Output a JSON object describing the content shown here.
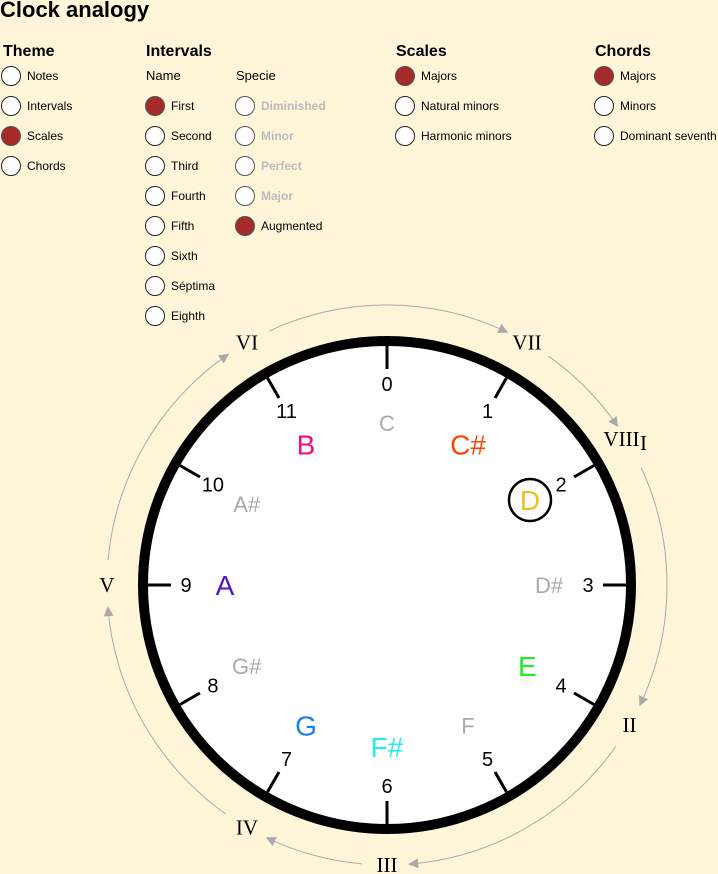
{
  "title": "Clock analogy",
  "theme": {
    "title": "Theme",
    "options": [
      {
        "label": "Notes",
        "selected": false
      },
      {
        "label": "Intervals",
        "selected": false
      },
      {
        "label": "Scales",
        "selected": true
      },
      {
        "label": "Chords",
        "selected": false
      }
    ]
  },
  "intervals": {
    "title": "Intervals",
    "name_header": "Name",
    "specie_header": "Specie",
    "names": [
      {
        "label": "First",
        "selected": true
      },
      {
        "label": "Second",
        "selected": false
      },
      {
        "label": "Third",
        "selected": false
      },
      {
        "label": "Fourth",
        "selected": false
      },
      {
        "label": "Fifth",
        "selected": false
      },
      {
        "label": "Sixth",
        "selected": false
      },
      {
        "label": "Séptima",
        "selected": false
      },
      {
        "label": "Eighth",
        "selected": false
      }
    ],
    "species": [
      {
        "label": "Diminished",
        "selected": false,
        "disabled": true
      },
      {
        "label": "Minor",
        "selected": false,
        "disabled": true
      },
      {
        "label": "Perfect",
        "selected": false,
        "disabled": true
      },
      {
        "label": "Major",
        "selected": false,
        "disabled": true
      },
      {
        "label": "Augmented",
        "selected": true,
        "disabled": false
      }
    ]
  },
  "scales": {
    "title": "Scales",
    "options": [
      {
        "label": "Majors",
        "selected": true
      },
      {
        "label": "Natural minors",
        "selected": false
      },
      {
        "label": "Harmonic minors",
        "selected": false
      }
    ]
  },
  "chords": {
    "title": "Chords",
    "options": [
      {
        "label": "Majors",
        "selected": true
      },
      {
        "label": "Minors",
        "selected": false
      },
      {
        "label": "Dominant seventh",
        "selected": false
      }
    ]
  },
  "clock": {
    "hours": [
      "0",
      "1",
      "2",
      "3",
      "4",
      "5",
      "6",
      "7",
      "8",
      "9",
      "10",
      "11"
    ],
    "notes": [
      {
        "name": "C",
        "color": "#aaaaaa"
      },
      {
        "name": "C#",
        "color": "#ff4400"
      },
      {
        "name": "D",
        "color": "#f0c020",
        "highlighted": true
      },
      {
        "name": "D#",
        "color": "#aaaaaa"
      },
      {
        "name": "E",
        "color": "#22ee22"
      },
      {
        "name": "F",
        "color": "#aaaaaa"
      },
      {
        "name": "F#",
        "color": "#22eeee"
      },
      {
        "name": "G",
        "color": "#1a7fe8"
      },
      {
        "name": "G#",
        "color": "#aaaaaa"
      },
      {
        "name": "A",
        "color": "#5511cc"
      },
      {
        "name": "A#",
        "color": "#aaaaaa"
      },
      {
        "name": "B",
        "color": "#ee1177"
      }
    ],
    "degrees": [
      {
        "label": "I",
        "hour": 2
      },
      {
        "label": "II",
        "hour": 4
      },
      {
        "label": "III",
        "hour": 6
      },
      {
        "label": "IV",
        "hour": 7
      },
      {
        "label": "V",
        "hour": 9
      },
      {
        "label": "VI",
        "hour": 11
      },
      {
        "label": "VII",
        "hour": 13
      },
      {
        "label": "VIII",
        "hour": 14
      }
    ]
  }
}
